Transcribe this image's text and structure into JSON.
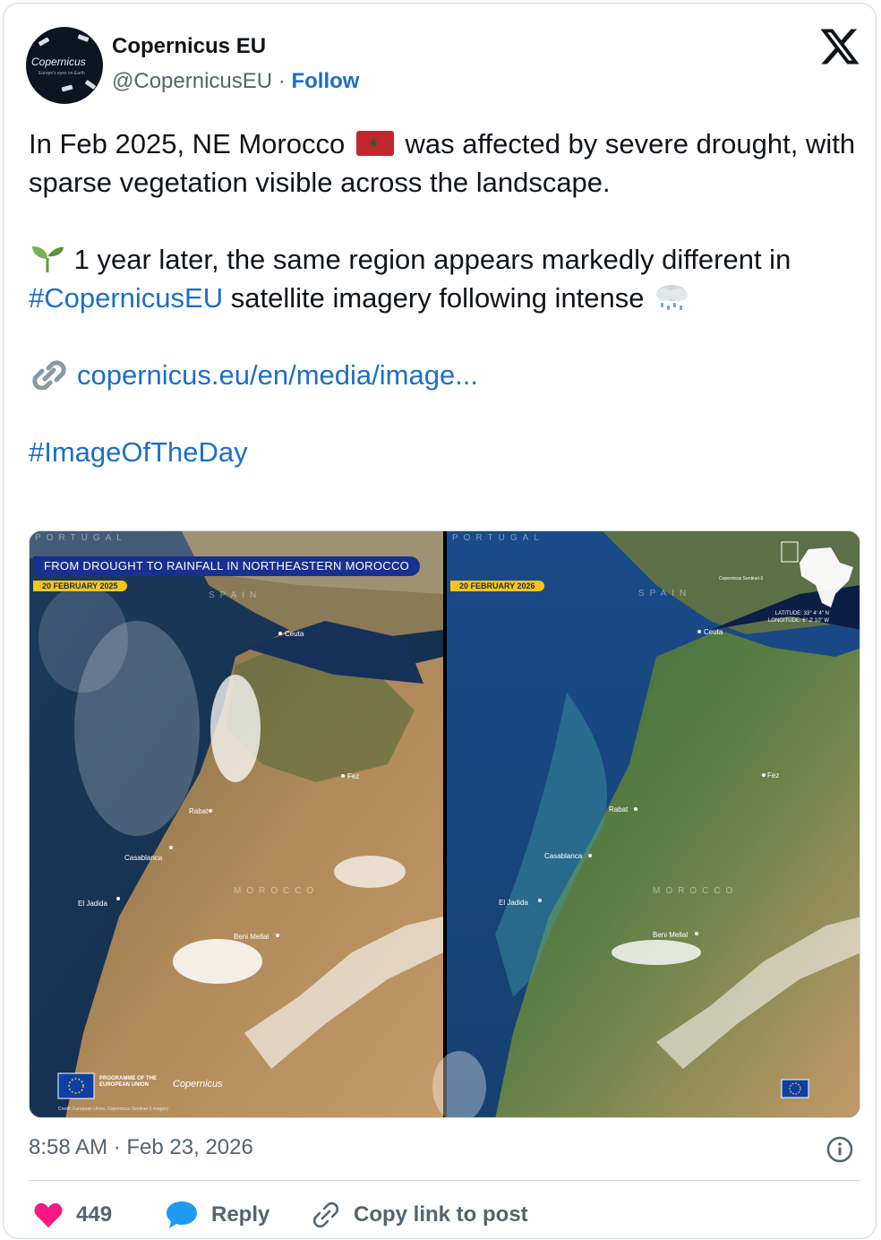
{
  "author": {
    "name": "Copernicus EU",
    "handle": "@CopernicusEU",
    "separator": "·",
    "follow_label": "Follow",
    "avatar_text": "Copernicus",
    "avatar_subtext": "Europe's eyes on Earth"
  },
  "platform_icon": "x-logo-icon",
  "post": {
    "p1_before_flag": "In Feb 2025, NE Morocco ",
    "p1_after_flag": " was affected by severe drought, with sparse vegetation visible across the landscape.",
    "p2_emoji": "seedling-icon",
    "p2_text": " 1 year later, the same region appears markedly different in ",
    "p2_hashtag": "#CopernicusEU",
    "p2_text_end": " satellite imagery following  intense ",
    "p2_end_emoji": "rain-cloud-icon",
    "link_icon": "link-icon",
    "link_text": "copernicus.eu/en/media/image...",
    "hashtag": "#ImageOfTheDay"
  },
  "image": {
    "banner": "FROM DROUGHT TO RAINFALL IN NORTHEASTERN MOROCCO",
    "left": {
      "date": "20 FEBRUARY 2025",
      "portugal": "PORTUGAL",
      "spain": "SPAIN",
      "morocco": "MOROCCO",
      "cities": [
        "Ceuta",
        "Fez",
        "Rabat",
        "Casablanca",
        "El Jadida",
        "Beni Mellal"
      ],
      "programme": "PROGRAMME OF THE EUROPEAN UNION",
      "logo_text": "Copernicus",
      "credit": "Credit: European Union, Copernicus Sentinel-3 imagery"
    },
    "right": {
      "date": "20 FEBRUARY 2026",
      "portugal": "PORTUGAL",
      "spain": "SPAIN",
      "morocco": "MOROCCO",
      "cities": [
        "Ceuta",
        "Fez",
        "Rabat",
        "Casablanca",
        "El Jadida",
        "Beni Mellal"
      ],
      "sensor": "Copernicus Sentinel-3",
      "latitude": "LATITUDE: 33° 4' 4\" N",
      "longitude": "LONGITUDE: 6° 2' 10\" W"
    }
  },
  "timestamp": "8:58 AM · Feb 23, 2026",
  "actions": {
    "like_count": "449",
    "reply_label": "Reply",
    "copy_label": "Copy link to post"
  },
  "colors": {
    "link": "#1d6ec9",
    "like": "#f91880",
    "reply": "#1d9bf0",
    "muted": "#536471"
  }
}
